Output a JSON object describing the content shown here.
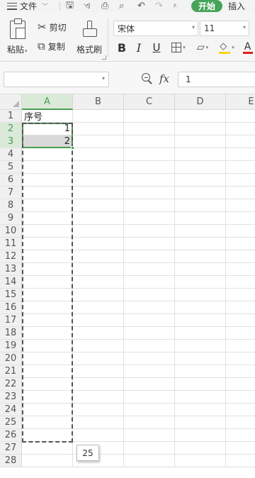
{
  "menubar": {
    "file_label": "文件",
    "tabs": [
      {
        "label": "开始",
        "active": true
      },
      {
        "label": "插入",
        "active": false
      }
    ],
    "accent_color": "#46a35a"
  },
  "ribbon": {
    "paste_label": "粘贴",
    "cut_label": "剪切",
    "copy_label": "复制",
    "format_painter_label": "格式刷",
    "font_name": "宋体",
    "font_size": "11",
    "bold_glyph": "B",
    "italic_glyph": "I",
    "underline_glyph": "U",
    "fill_color": "#f5d51c",
    "font_color": "#e02020",
    "font_color_glyph": "A"
  },
  "formula_bar": {
    "name_box_value": "",
    "fx_label": "fx",
    "formula_value": "1"
  },
  "sheet": {
    "columns": [
      "A",
      "B",
      "C",
      "D",
      "E"
    ],
    "active_column": "A",
    "rows": [
      "1",
      "2",
      "3",
      "4",
      "5",
      "6",
      "7",
      "8",
      "9",
      "10",
      "11",
      "12",
      "13",
      "14",
      "15",
      "16",
      "17",
      "18",
      "19",
      "20",
      "21",
      "22",
      "23",
      "24",
      "25",
      "26",
      "27",
      "28"
    ],
    "active_rows": [
      "2",
      "3"
    ],
    "cells": {
      "A1": "序号",
      "A2": "1",
      "A3": "2"
    },
    "autofill_tooltip": "25"
  }
}
